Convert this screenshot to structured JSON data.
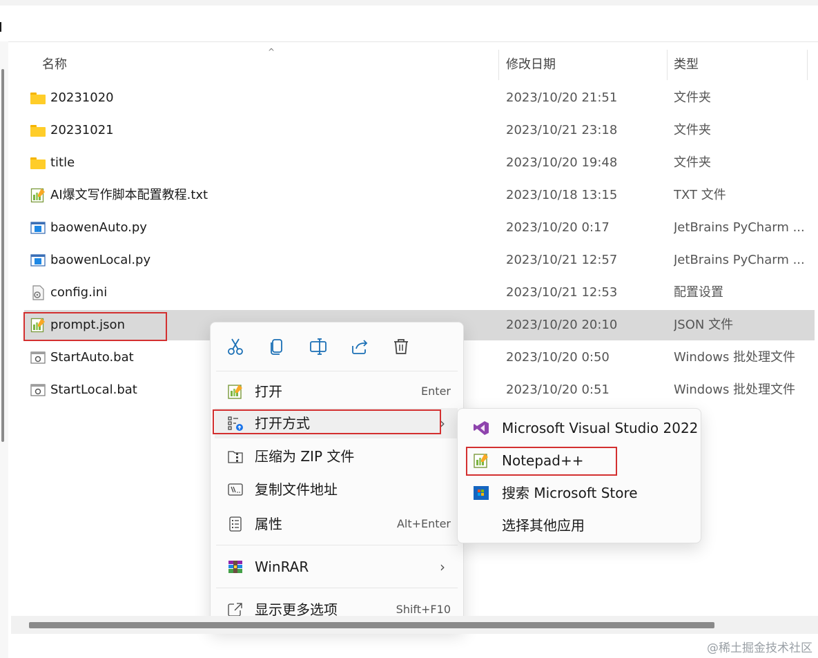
{
  "columns": {
    "name": "名称",
    "date": "修改日期",
    "type": "类型"
  },
  "files": [
    {
      "name": "20231020",
      "date": "2023/10/20 21:51",
      "type": "文件夹",
      "icon": "folder-icon"
    },
    {
      "name": "20231021",
      "date": "2023/10/21 23:18",
      "type": "文件夹",
      "icon": "folder-icon"
    },
    {
      "name": "title",
      "date": "2023/10/20 19:48",
      "type": "文件夹",
      "icon": "folder-icon"
    },
    {
      "name": "AI爆文写作脚本配置教程.txt",
      "date": "2023/10/18 13:15",
      "type": "TXT 文件",
      "icon": "notepad-file-icon"
    },
    {
      "name": "baowenAuto.py",
      "date": "2023/10/20 0:17",
      "type": "JetBrains PyCharm ...",
      "icon": "pycharm-file-icon"
    },
    {
      "name": "baowenLocal.py",
      "date": "2023/10/21 12:57",
      "type": "JetBrains PyCharm ...",
      "icon": "pycharm-file-icon"
    },
    {
      "name": "config.ini",
      "date": "2023/10/21 12:53",
      "type": "配置设置",
      "icon": "config-file-icon"
    },
    {
      "name": "prompt.json",
      "date": "2023/10/20 20:10",
      "type": "JSON 文件",
      "icon": "notepad-file-icon",
      "selected": true
    },
    {
      "name": "StartAuto.bat",
      "date": "2023/10/20 0:50",
      "type": "Windows 批处理文件",
      "icon": "batch-file-icon"
    },
    {
      "name": "StartLocal.bat",
      "date": "2023/10/20 0:51",
      "type": "Windows 批处理文件",
      "icon": "batch-file-icon"
    }
  ],
  "context_menu": {
    "quick_actions": [
      "cut-icon",
      "copy-icon",
      "rename-icon",
      "share-icon",
      "delete-icon"
    ],
    "open": {
      "label": "打开",
      "shortcut": "Enter"
    },
    "open_with": {
      "label": "打开方式"
    },
    "compress_zip": {
      "label": "压缩为 ZIP 文件"
    },
    "copy_path": {
      "label": "复制文件地址"
    },
    "properties": {
      "label": "属性",
      "shortcut": "Alt+Enter"
    },
    "winrar": {
      "label": "WinRAR"
    },
    "more_options": {
      "label": "显示更多选项",
      "shortcut": "Shift+F10"
    }
  },
  "submenu": {
    "visual_studio": "Microsoft Visual Studio 2022",
    "notepadpp": "Notepad++",
    "store": "搜索 Microsoft Store",
    "other_app": "选择其他应用"
  },
  "watermark": "@稀土掘金技术社区",
  "colors": {
    "highlight_box": "#d32f2f",
    "selected_row": "#d9d9d9",
    "folder": "#ffcd29"
  }
}
